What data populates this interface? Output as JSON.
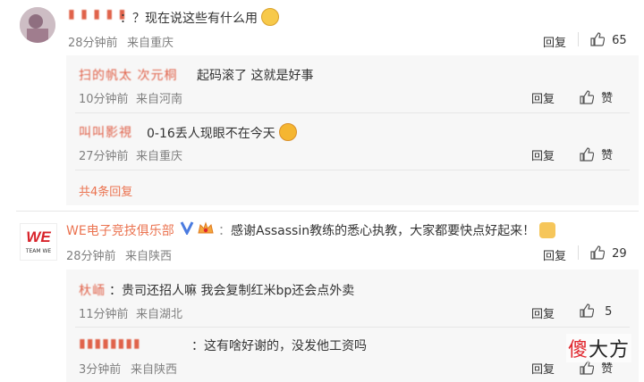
{
  "top_comment": {
    "username": "▮ ▮ ▮ ▮ ▮",
    "text": "：？现在说这些有什么用",
    "time": "28分钟前",
    "location": "来自重庆",
    "reply_label": "回复",
    "likes": "65",
    "replies": [
      {
        "username": "扫的帆太 次元桐",
        "text": "起码滚了 这就是好事",
        "time": "10分钟前",
        "location": "来自河南",
        "reply_label": "回复",
        "likes": "赞"
      },
      {
        "username": "叫叫影視",
        "text": "0-16丢人现眼不在今天",
        "time": "27分钟前",
        "location": "来自重庆",
        "reply_label": "回复",
        "likes": "赞"
      }
    ],
    "more_replies": "共4条回复"
  },
  "second_comment": {
    "username": "WE电子竞技俱乐部",
    "text": "感谢Assassin教练的悉心执教，大家都要快点好起来！",
    "time": "28分钟前",
    "location": "来自陕西",
    "reply_label": "回复",
    "likes": "29",
    "logo_text": "WE",
    "logo_sub": "TEAM WE",
    "replies": [
      {
        "username": "杕峏",
        "text": "贵司还招人嘛 我会复制红米bp还会点外卖",
        "time": "11分钟前",
        "location": "来自湖北",
        "reply_label": "回复",
        "likes": "5"
      },
      {
        "username": "▮▮▮▮▮▮▮▮",
        "text": "这有啥好谢的，没发他工资吗",
        "time": "3分钟前",
        "location": "来自陕西",
        "reply_label": "回复",
        "likes": "赞"
      }
    ]
  },
  "watermark": {
    "part1": "傻",
    "part2": "大方"
  },
  "colors": {
    "username": "#eb7350",
    "meta": "#808080",
    "reply_bg": "#f7f7f7",
    "vip": "#4a7be0"
  }
}
